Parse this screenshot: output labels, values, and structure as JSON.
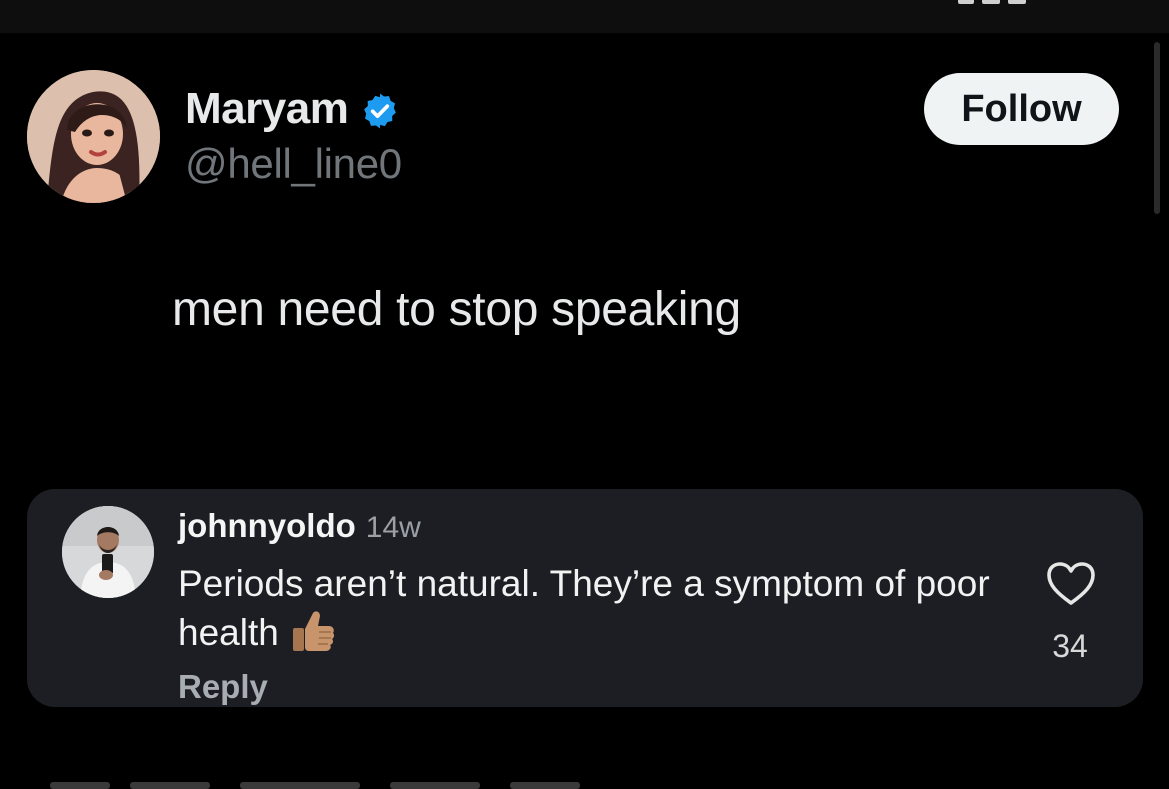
{
  "post": {
    "author": {
      "display_name": "Maryam",
      "handle": "@hell_line0",
      "verified_icon": "verified-badge-icon",
      "verified_color": "#1d9bf0"
    },
    "follow_label": "Follow",
    "text": "men need to stop speaking"
  },
  "comment": {
    "username": "johnnyoldo",
    "time_ago": "14w",
    "body": "Periods aren’t natural. They’re a symptom of poor health",
    "emoji_icon": "thumbs-up-icon",
    "reply_label": "Reply",
    "like_icon": "heart-outline-icon",
    "like_count": "34"
  },
  "colors": {
    "background": "#000000",
    "card": "#1c1e23",
    "follow_bg": "#eff3f4",
    "handle_gray": "#71767b"
  }
}
